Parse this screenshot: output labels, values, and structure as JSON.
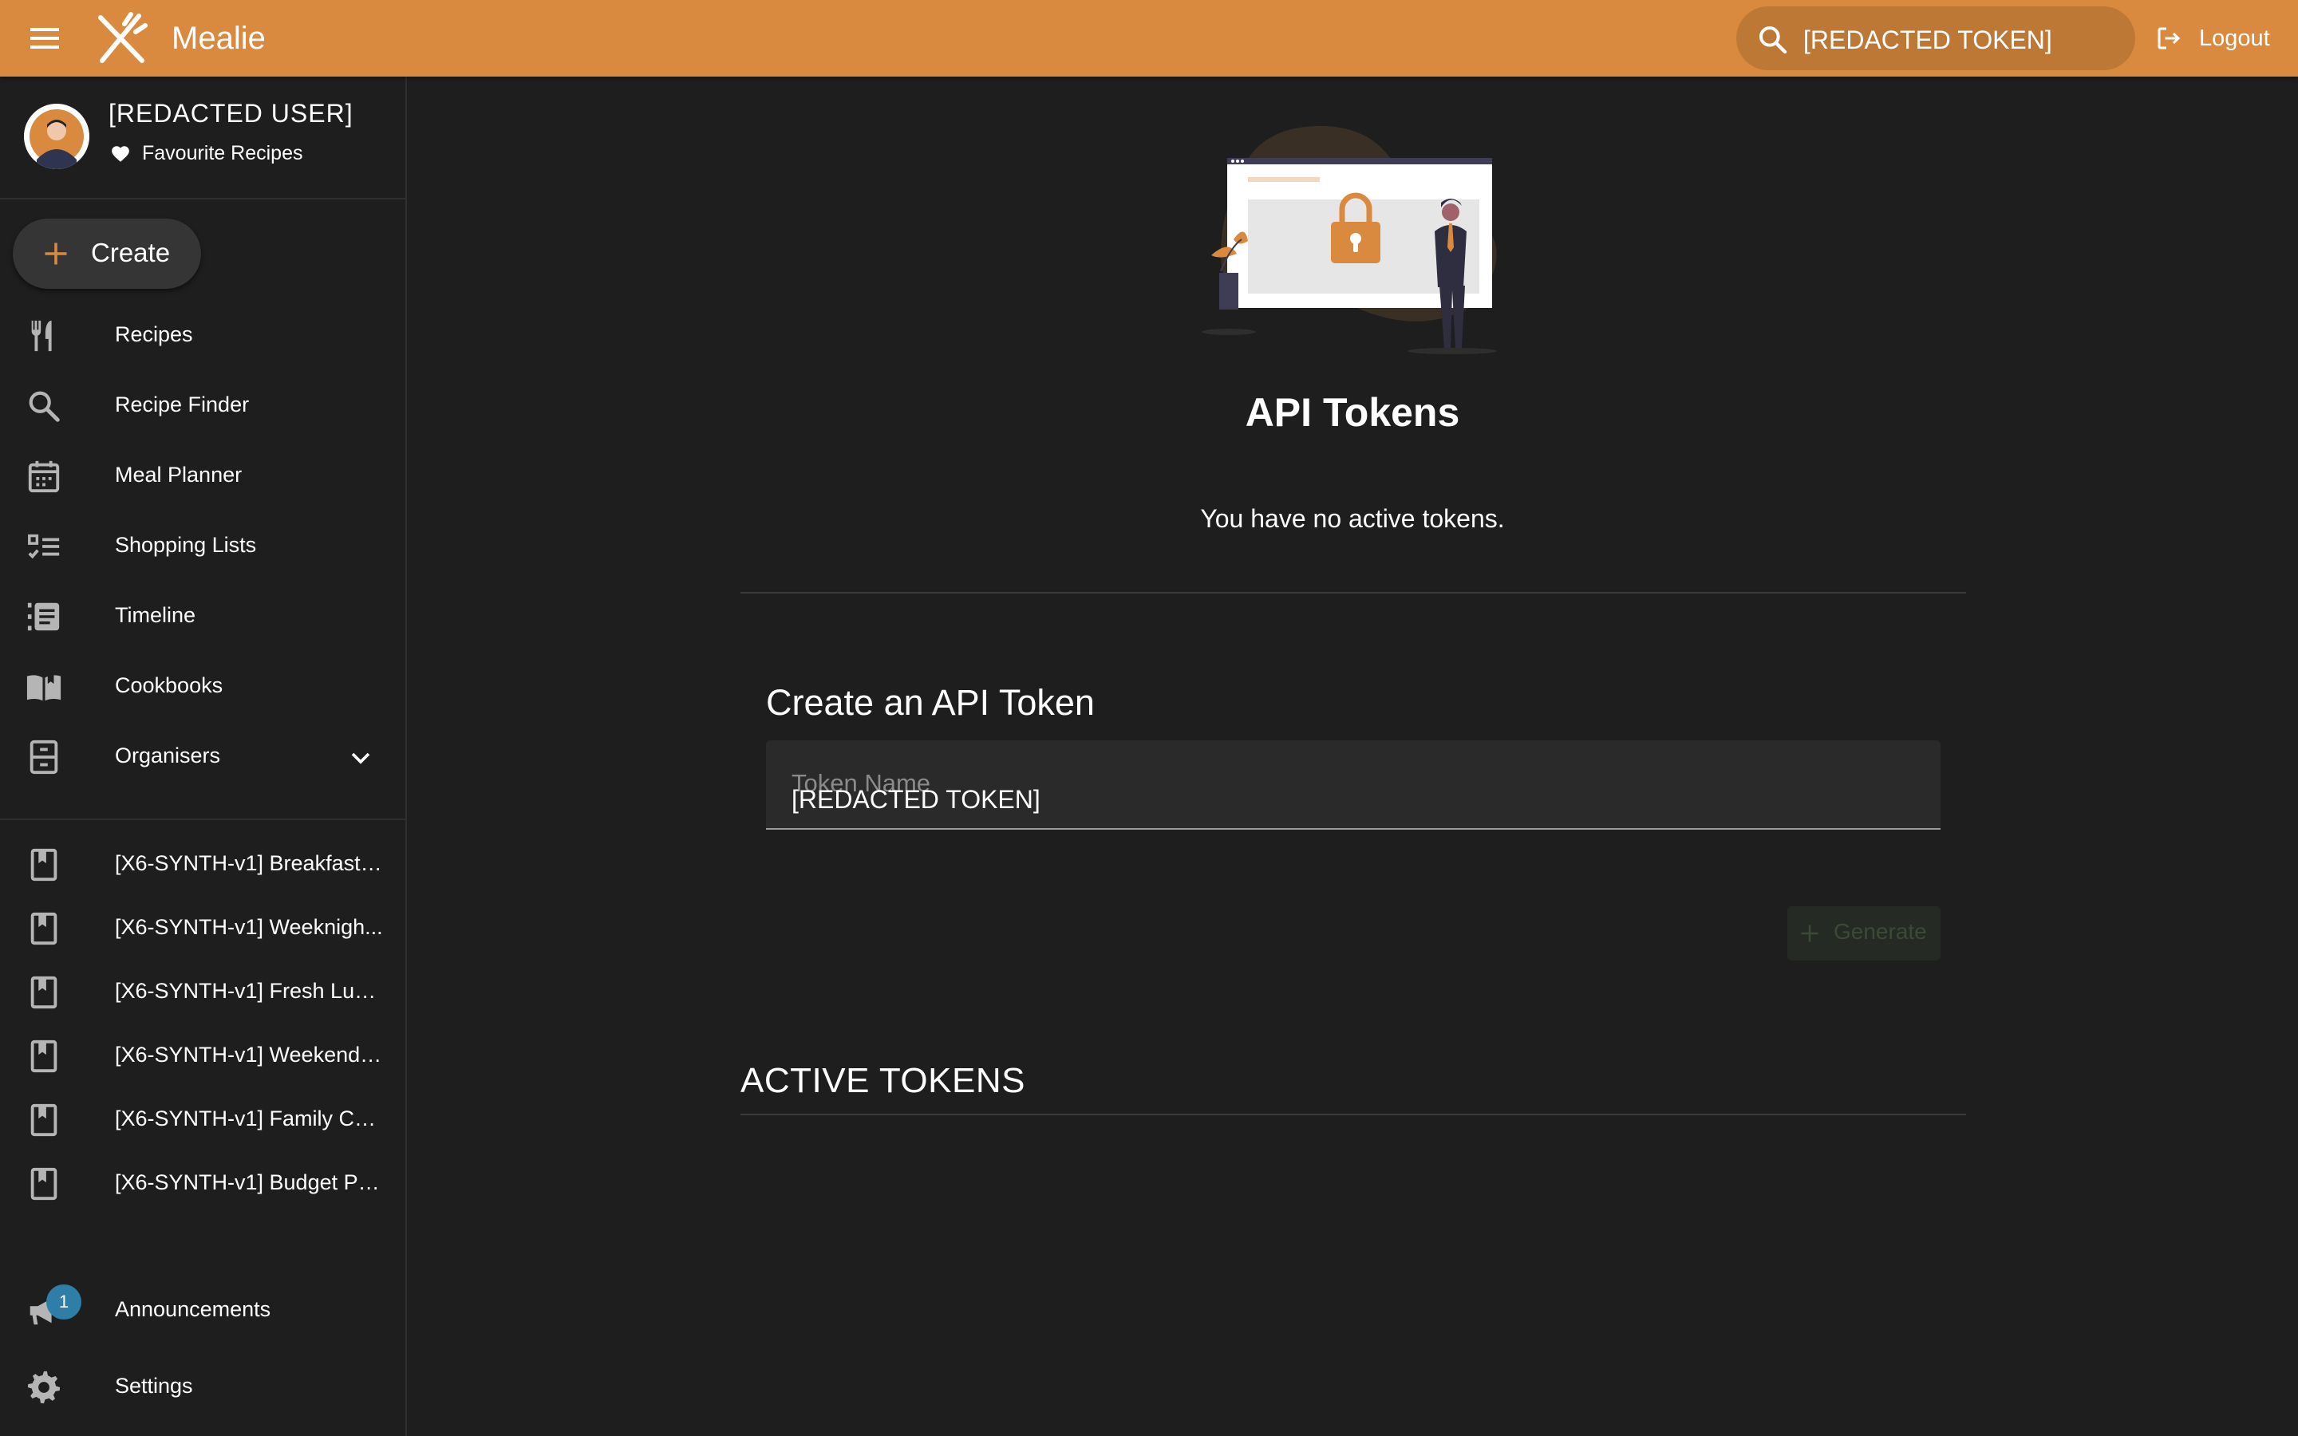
{
  "app": {
    "title": "Mealie"
  },
  "search": {
    "value": "[REDACTED TOKEN]"
  },
  "header": {
    "logout_label": "Logout"
  },
  "user": {
    "name": "[REDACTED USER]",
    "favourites_label": "Favourite Recipes"
  },
  "sidebar": {
    "create_label": "Create",
    "nav": [
      {
        "label": "Recipes",
        "icon": "cutlery-icon"
      },
      {
        "label": "Recipe Finder",
        "icon": "search-icon"
      },
      {
        "label": "Meal Planner",
        "icon": "calendar-icon"
      },
      {
        "label": "Shopping Lists",
        "icon": "checklist-icon"
      },
      {
        "label": "Timeline",
        "icon": "timeline-icon"
      },
      {
        "label": "Cookbooks",
        "icon": "book-open-icon"
      },
      {
        "label": "Organisers",
        "icon": "file-cabinet-icon"
      }
    ],
    "cookbooks": [
      {
        "label": "[X6-SYNTH-v1] Breakfast ..."
      },
      {
        "label": "[X6-SYNTH-v1] Weeknigh..."
      },
      {
        "label": "[X6-SYNTH-v1] Fresh Lun..."
      },
      {
        "label": "[X6-SYNTH-v1] Weekend ..."
      },
      {
        "label": "[X6-SYNTH-v1] Family Co..."
      },
      {
        "label": "[X6-SYNTH-v1] Budget Pa..."
      }
    ],
    "announcements": {
      "label": "Announcements",
      "badge_count": "1"
    },
    "settings_label": "Settings"
  },
  "main": {
    "title": "API Tokens",
    "empty_message": "You have no active tokens.",
    "create_section_title": "Create an API Token",
    "token_field": {
      "label": "Token Name",
      "value": "[REDACTED TOKEN]"
    },
    "generate_label": "Generate",
    "active_tokens_title": "ACTIVE TOKENS"
  },
  "colors": {
    "primary": "#d98a3e",
    "background": "#1e1e1e",
    "badge": "#2f7ea8",
    "icon": "#b5b5b5"
  }
}
